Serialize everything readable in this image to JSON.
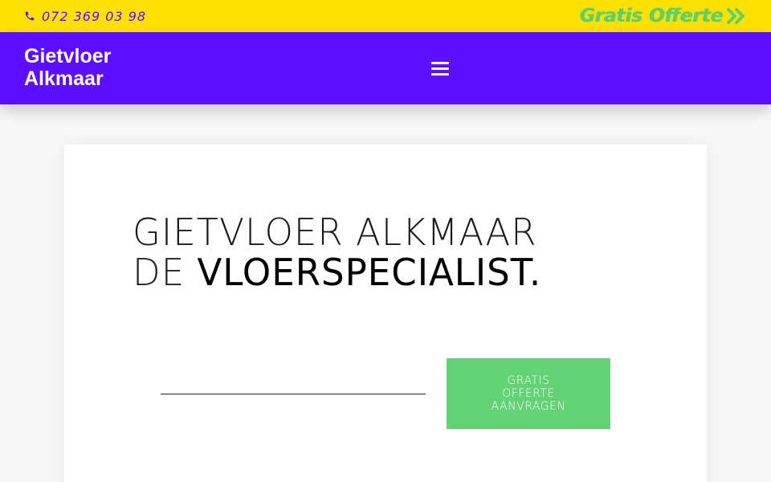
{
  "topbar": {
    "phone": "072 369 03 98",
    "phone_icon": "phone-icon",
    "offer_label": "Gratis Offerte",
    "offer_icon": "double-chevron-right-icon"
  },
  "header": {
    "brand_line1": "Gietvloer",
    "brand_line2": "Alkmaar",
    "menu_icon": "hamburger-menu-icon"
  },
  "hero": {
    "line1": "GIETVLOER ALKMAAR",
    "line2_light": "DE",
    "line2_strong": "VLOERSPECIALIST."
  },
  "cta": {
    "label": "GRATIS OFFERTE AANVRAGEN"
  },
  "colors": {
    "topbar_bg": "#ffe100",
    "header_bg": "#5a10ff",
    "accent_green": "#62d275"
  }
}
